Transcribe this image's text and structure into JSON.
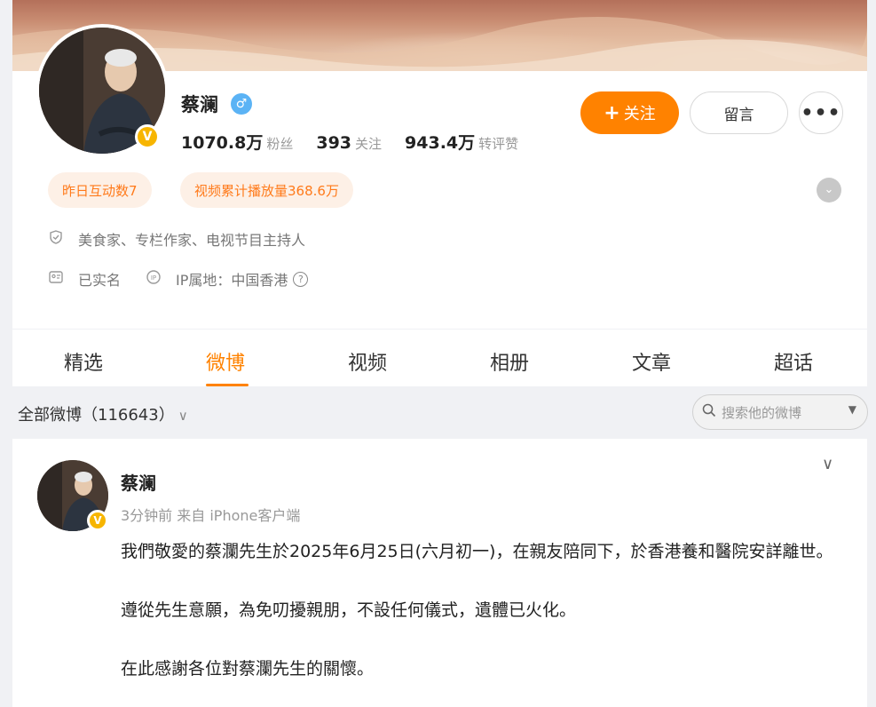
{
  "profile": {
    "name": "蔡澜",
    "gender_symbol": "♂",
    "verified_mark": "V",
    "stats": [
      {
        "number": "1070.8万",
        "label": "粉丝"
      },
      {
        "number": "393",
        "label": "关注"
      },
      {
        "number": "943.4万",
        "label": "转评赞"
      }
    ],
    "follow_label": "关注",
    "message_label": "留言",
    "more_label": "•••",
    "tags": [
      "昨日互动数7",
      "视频累计播放量368.6万"
    ],
    "description": "美食家、专栏作家、电视节目主持人",
    "real_name_label": "已实名",
    "ip_label": "IP属地：中国香港",
    "ip_help": "?"
  },
  "tabs": [
    {
      "label": "精选"
    },
    {
      "label": "微博"
    },
    {
      "label": "视频"
    },
    {
      "label": "相册"
    },
    {
      "label": "文章"
    },
    {
      "label": "超话"
    }
  ],
  "active_tab": "微博",
  "filter": {
    "label": "全部微博（116643）"
  },
  "search": {
    "placeholder": "搜索他的微博"
  },
  "post": {
    "author": "蔡澜",
    "meta": "3分钟前 来自 iPhone客户端",
    "paragraphs": [
      "我們敬愛的蔡瀾先生於2025年6月25日(六月初一)，在親友陪同下，於香港養和醫院安詳離世。",
      "遵從先生意願，為免叨擾親朋，不設任何儀式，遺體已火化。",
      "在此感謝各位對蔡瀾先生的關懷。"
    ]
  },
  "colors": {
    "accent": "#ff8200",
    "tag_bg": "#fdf0e6",
    "verified": "#f7b500",
    "gender": "#5bb3f5"
  },
  "icons": {
    "description": "shield-icon",
    "real_name": "id-card-icon",
    "ip": "ip-location-icon",
    "search": "search-icon",
    "more": "more-dots-icon"
  }
}
